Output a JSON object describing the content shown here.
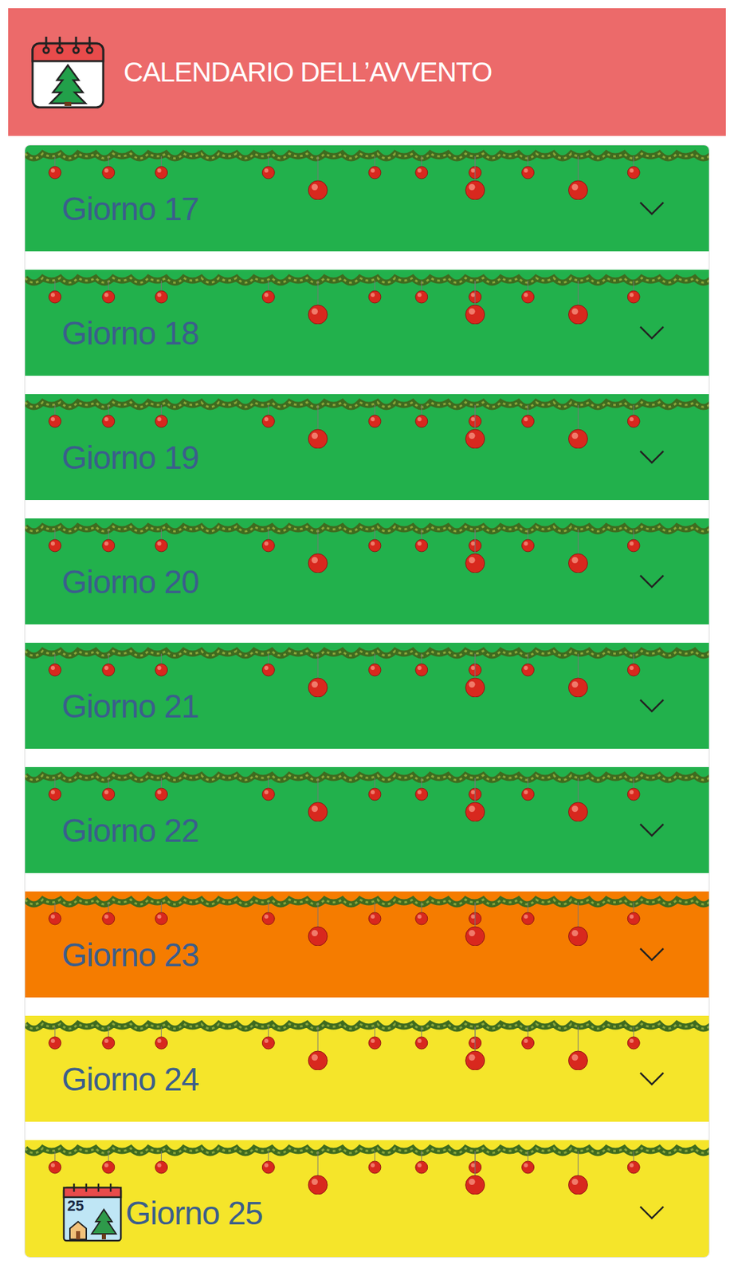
{
  "header": {
    "title": "CALENDARIO DELL’AVVENTO"
  },
  "days": [
    {
      "label": "Giorno 17",
      "color": "#22b14c",
      "expanded": false,
      "kind": "plain"
    },
    {
      "label": "Giorno 18",
      "color": "#22b14c",
      "expanded": false,
      "kind": "plain"
    },
    {
      "label": "Giorno 19",
      "color": "#22b14c",
      "expanded": false,
      "kind": "plain"
    },
    {
      "label": "Giorno 20",
      "color": "#22b14c",
      "expanded": false,
      "kind": "plain"
    },
    {
      "label": "Giorno 21",
      "color": "#22b14c",
      "expanded": false,
      "kind": "plain"
    },
    {
      "label": "Giorno 22",
      "color": "#22b14c",
      "expanded": false,
      "kind": "plain"
    },
    {
      "label": "Giorno 23",
      "color": "#f57c00",
      "expanded": false,
      "kind": "plain"
    },
    {
      "label": "Giorno 24",
      "color": "#f5e52a",
      "expanded": false,
      "kind": "plain"
    },
    {
      "label": "Giorno 25",
      "color": "#f5e52a",
      "expanded": false,
      "kind": "icon",
      "icon_text": "25"
    }
  ]
}
